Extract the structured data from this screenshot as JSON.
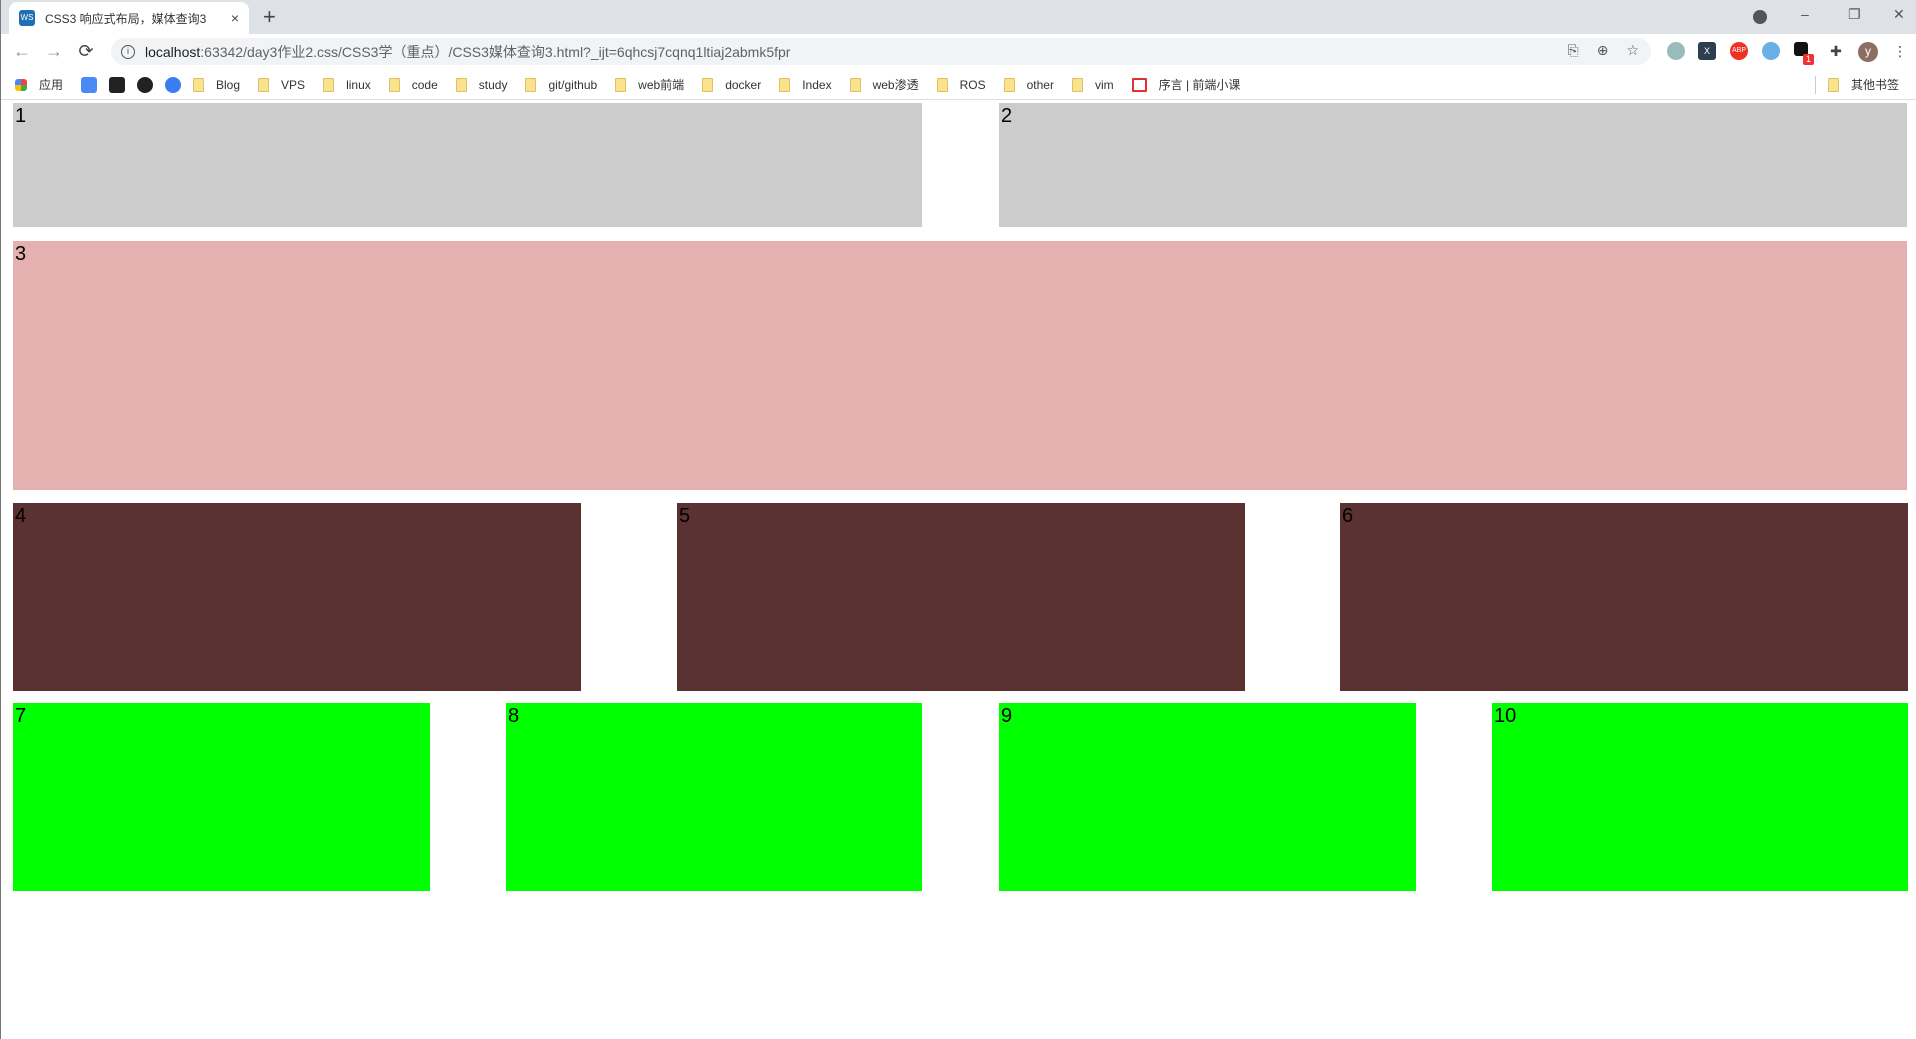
{
  "tab": {
    "title": "CSS3 响应式布局，媒体查询3",
    "close": "×",
    "new_tab": "+"
  },
  "window": {
    "minimize": "–",
    "restore": "❐",
    "close": "✕"
  },
  "address": {
    "host": "localhost",
    "path": ":63342/day3作业2.css/CSS3学（重点）/CSS3媒体查询3.html?_ijt=6qhcsj7cqnq1ltiaj2abmk5fpr"
  },
  "nav": {
    "back": "←",
    "forward": "→",
    "reload": "⟳"
  },
  "extensions": {
    "abp": "ABP",
    "x": "X",
    "badge": "1",
    "avatar": "y"
  },
  "bookmarks": {
    "apps": "应用",
    "items": [
      "Blog",
      "VPS",
      "linux",
      "code",
      "study",
      "git/github",
      "web前端",
      "docker",
      "Index",
      "web渗透",
      "ROS",
      "other",
      "vim"
    ],
    "special": "序言 | 前端小课",
    "other": "其他书签"
  },
  "boxes": [
    "1",
    "2",
    "3",
    "4",
    "5",
    "6",
    "7",
    "8",
    "9",
    "10"
  ],
  "colors": {
    "gray": "#cccccc",
    "pink": "#e4b1b0",
    "brown": "#5b3232",
    "green": "#00ff00"
  }
}
